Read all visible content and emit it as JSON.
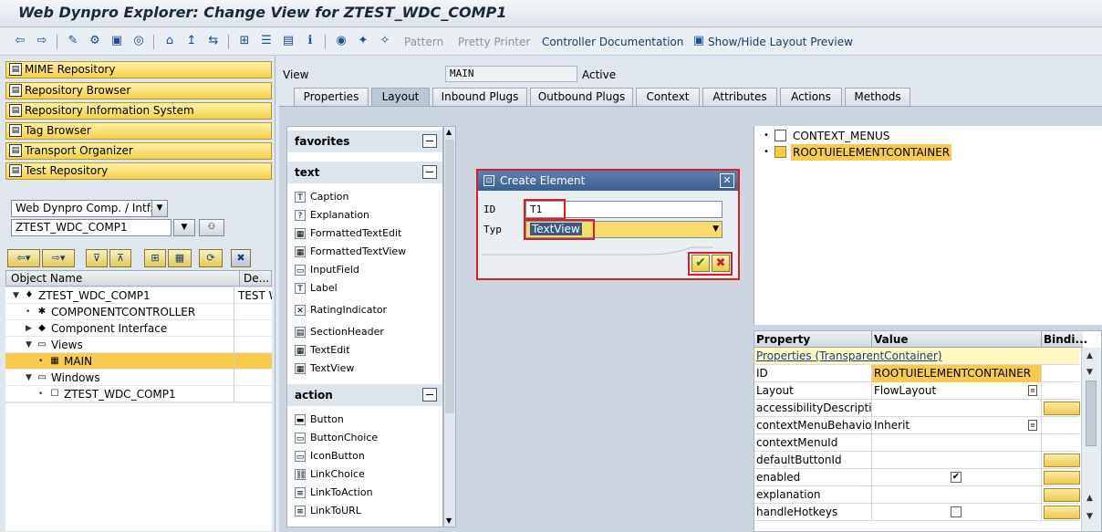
{
  "window": {
    "title": "Web Dynpro Explorer: Change View for ZTEST_WDC_COMP1"
  },
  "toolbar": {
    "buttons": [
      {
        "icon": "back-arrow-icon",
        "glyph": "⇦"
      },
      {
        "icon": "forward-arrow-icon",
        "glyph": "⇨"
      },
      {
        "icon": "edit-pencil-icon",
        "glyph": "✎"
      },
      {
        "icon": "display-change-icon",
        "glyph": "⚙"
      },
      {
        "icon": "other-object-icon",
        "glyph": "▣"
      },
      {
        "icon": "activate-icon",
        "glyph": "◎"
      },
      {
        "icon": "check-icon",
        "glyph": "⌂"
      },
      {
        "icon": "where-used-icon",
        "glyph": "↥"
      },
      {
        "icon": "navigate-icon",
        "glyph": "⇆"
      },
      {
        "icon": "hierarchy-icon",
        "glyph": "⊞"
      },
      {
        "icon": "object-list-icon",
        "glyph": "☰"
      },
      {
        "icon": "table-icon",
        "glyph": "▤"
      },
      {
        "icon": "info-icon",
        "glyph": "ℹ"
      },
      {
        "icon": "test-icon",
        "glyph": "◉"
      },
      {
        "icon": "debug-icon",
        "glyph": "✦"
      },
      {
        "icon": "wizard-icon",
        "glyph": "✧"
      }
    ],
    "pattern": "Pattern",
    "pretty_printer": "Pretty Printer",
    "controller_documentation": "Controller Documentation",
    "show_hide_layout_preview": "Show/Hide Layout Preview"
  },
  "navigator": {
    "buttons": [
      {
        "label": "MIME Repository",
        "icon": "mime-repository-icon"
      },
      {
        "label": "Repository Browser",
        "icon": "repository-browser-icon"
      },
      {
        "label": "Repository Information System",
        "icon": "repository-info-icon"
      },
      {
        "label": "Tag Browser",
        "icon": "tag-browser-icon"
      },
      {
        "label": "Transport Organizer",
        "icon": "transport-organizer-icon"
      },
      {
        "label": "Test Repository",
        "icon": "test-repository-icon"
      }
    ],
    "object_type": "Web Dynpro Comp. / Intf.",
    "object_name": "ZTEST_WDC_COMP1",
    "tree_header": {
      "col1": "Object Name",
      "col2": "De..."
    },
    "tree": [
      {
        "label": "ZTEST_WDC_COMP1",
        "desc": "TEST W",
        "indent": 0,
        "expander": "▼",
        "icon": "component-icon"
      },
      {
        "label": "COMPONENTCONTROLLER",
        "desc": "",
        "indent": 1,
        "expander": "•",
        "icon": "controller-icon"
      },
      {
        "label": "Component Interface",
        "desc": "",
        "indent": 1,
        "expander": "▶",
        "icon": "interface-icon"
      },
      {
        "label": "Views",
        "desc": "",
        "indent": 1,
        "expander": "▼",
        "icon": "folder-icon"
      },
      {
        "label": "MAIN",
        "desc": "",
        "indent": 2,
        "expander": "•",
        "icon": "view-icon",
        "selected": true
      },
      {
        "label": "Windows",
        "desc": "",
        "indent": 1,
        "expander": "▼",
        "icon": "folder-icon"
      },
      {
        "label": "ZTEST_WDC_COMP1",
        "desc": "",
        "indent": 2,
        "expander": "•",
        "icon": "window-icon"
      }
    ]
  },
  "view_header": {
    "view_label": "View",
    "view_value": "MAIN",
    "status": "Active"
  },
  "tabs": [
    "Properties",
    "Layout",
    "Inbound Plugs",
    "Outbound Plugs",
    "Context",
    "Attributes",
    "Actions",
    "Methods"
  ],
  "active_tab": "Layout",
  "palette": {
    "groups": [
      {
        "title": "favorites",
        "items": []
      },
      {
        "title": "text",
        "items": [
          {
            "label": "Caption",
            "glyph": "T"
          },
          {
            "label": "Explanation",
            "glyph": "?"
          },
          {
            "label": "FormattedTextEdit",
            "glyph": "▦"
          },
          {
            "label": "FormattedTextView",
            "glyph": "▦"
          },
          {
            "label": "InputField",
            "glyph": "▭"
          },
          {
            "label": "Label",
            "glyph": "T"
          },
          {
            "label": "RatingIndicator",
            "glyph": "✕"
          },
          {
            "label": "SectionHeader",
            "glyph": "▤"
          },
          {
            "label": "TextEdit",
            "glyph": "▦"
          },
          {
            "label": "TextView",
            "glyph": "▦"
          }
        ]
      },
      {
        "title": "action",
        "items": [
          {
            "label": "Button",
            "glyph": "▬"
          },
          {
            "label": "ButtonChoice",
            "glyph": "▭"
          },
          {
            "label": "IconButton",
            "glyph": "▭"
          },
          {
            "label": "LinkChoice",
            "glyph": "⛓"
          },
          {
            "label": "LinkToAction",
            "glyph": "≡"
          },
          {
            "label": "LinkToURL",
            "glyph": "≡"
          }
        ]
      }
    ]
  },
  "dialog": {
    "title": "Create Element",
    "id_label": "ID",
    "id_value": "T1",
    "type_label": "Typ",
    "type_value": "TextView"
  },
  "context_tree": [
    {
      "label": "CONTEXT_MENUS",
      "highlight": false
    },
    {
      "label": "ROOTUIELEMENTCONTAINER",
      "highlight": true
    }
  ],
  "properties": {
    "headers": {
      "property": "Property",
      "value": "Value",
      "binding": "Bindi..."
    },
    "section": "Properties (TransparentContainer)",
    "rows": [
      {
        "name": "ID",
        "value": "ROOTUIELEMENTCONTAINER",
        "kind": "highlight",
        "bind": false
      },
      {
        "name": "Layout",
        "value": "FlowLayout",
        "kind": "select",
        "bind": false
      },
      {
        "name": "accessibilityDescription",
        "value": "",
        "kind": "text",
        "bind": true
      },
      {
        "name": "contextMenuBehavio...",
        "value": "Inherit",
        "kind": "select",
        "bind": false
      },
      {
        "name": "contextMenuId",
        "value": "",
        "kind": "text",
        "bind": false
      },
      {
        "name": "defaultButtonId",
        "value": "",
        "kind": "text",
        "bind": true
      },
      {
        "name": "enabled",
        "value": "",
        "kind": "checkbox",
        "checked": true,
        "bind": true
      },
      {
        "name": "explanation",
        "value": "",
        "kind": "text",
        "bind": true
      },
      {
        "name": "handleHotkeys",
        "value": "",
        "kind": "checkbox",
        "checked": false,
        "bind": true
      }
    ]
  },
  "colors": {
    "accent_red": "#d3202a",
    "selection_yellow": "#f7cb4d",
    "sap_blue": "#3c5f92"
  }
}
